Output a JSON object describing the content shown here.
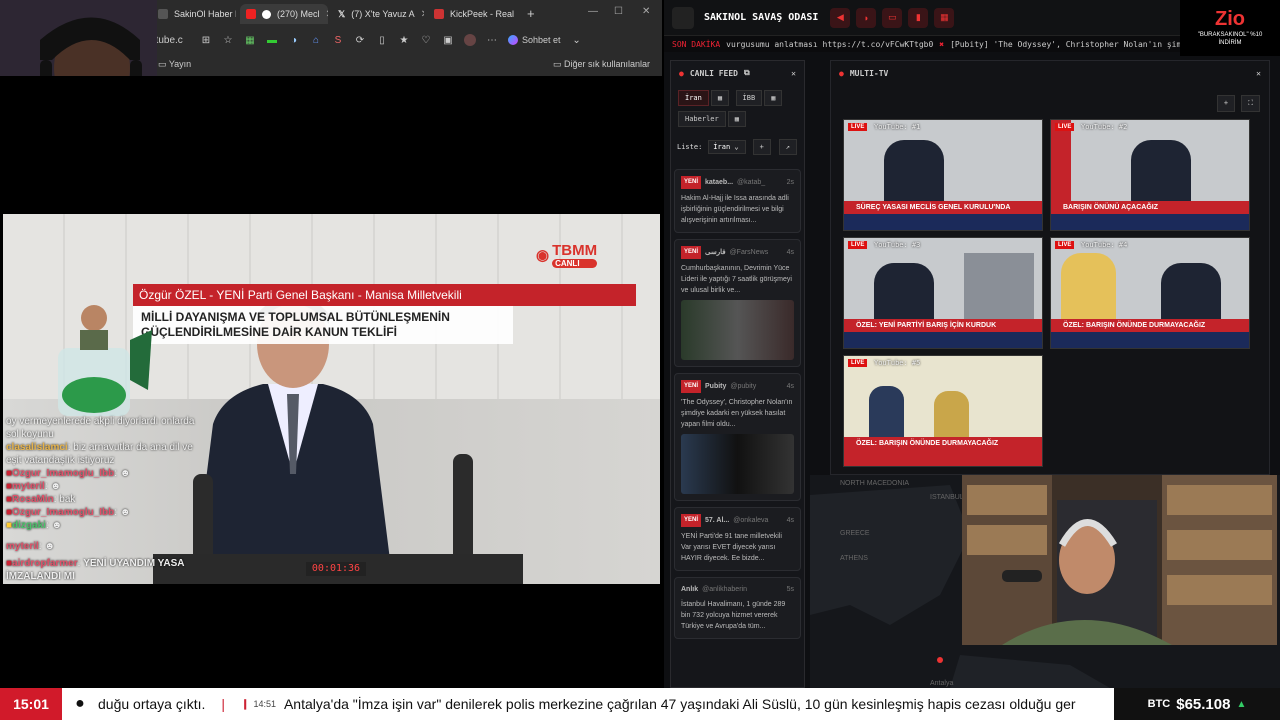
{
  "browser": {
    "tabs": [
      {
        "label": "SakinOl Haber N"
      },
      {
        "label": "(270) Mecl"
      },
      {
        "label": "(7) X'te Yavuz A"
      },
      {
        "label": "KickPeek - Real"
      }
    ],
    "address": "utube.c",
    "profile_button": "Sohbet et",
    "bookmark_1": "Yayın",
    "bookmark_other": "Diğer sık kullanılanlar"
  },
  "stream": {
    "channel_logo": "TBMM",
    "channel_sub": "CANLI",
    "speaker_line": "Özgür ÖZEL - YENİ Parti Genel Başkanı - Manisa Milletvekili",
    "topic_line1": "MİLLİ DAYANIŞMA VE TOPLUMSAL BÜTÜNLEŞMENİN",
    "topic_line2": "GÜÇLENDİRİLMESİNE DAİR KANUN TEKLİFİ",
    "timer": "00:01:36"
  },
  "chat": [
    {
      "user": "",
      "text": "oy vermeyenlerede akpli diyorlardı onlarda sol koyunu",
      "color": "#ddd"
    },
    {
      "user": "clasalislamci",
      "text": "biz arnavutlar da ana dil ve eşit vatandaşlık istiyoruz",
      "color": "#e6b34a"
    },
    {
      "user": "Ozgur_Imamoglu_Ibb",
      "text": "",
      "color": "#e0526a"
    },
    {
      "user": "myteril",
      "text": "",
      "color": "#e0526a"
    },
    {
      "user": "RosaMin",
      "text": "bak",
      "color": "#e0526a"
    },
    {
      "user": "Ozgur_Imamoglu_Ibb",
      "text": "",
      "color": "#e0526a"
    },
    {
      "user": "dizgaki",
      "text": "",
      "color": "#4ac26a"
    },
    {
      "user": "myteril",
      "text": "",
      "color": "#e0526a"
    },
    {
      "user": "airdropfarmer",
      "text": "YENİ UYANDIM YASA İMZALANDI MI",
      "color": "#e0526a"
    }
  ],
  "dashboard": {
    "title": "SAKINOL SAVAŞ ODASI",
    "ticker_tag": "SON DAKİKA",
    "ticker_text": "vurgusumu anlatması https://t.co/vFCwKTtgb0",
    "ticker_text2": "[Pubity] 'The Odyssey', Christopher Nolan'ın şimdiye kadarki en y",
    "feed_title": "CANLI FEED",
    "chips": [
      "İran",
      "İBB",
      "Haberler"
    ],
    "list_label": "Liste:",
    "list_value": "İran",
    "multitv_title": "MULTI-TV",
    "tiles": [
      {
        "label": "YouTube: #1",
        "banner": "SÜREÇ YASASI MECLİS GENEL KURULU'NDA"
      },
      {
        "label": "YouTube: #2",
        "banner": "BARIŞIN ÖNÜNÜ AÇACAĞIZ"
      },
      {
        "label": "YouTube: #3",
        "banner": "ÖZEL: YENİ PARTİYİ BARIŞ İÇİN KURDUK"
      },
      {
        "label": "YouTube: #4",
        "banner": "ÖZEL: BARIŞIN ÖNÜNDE DURMAYACAĞIZ"
      },
      {
        "label": "YouTube: #5",
        "banner": "ÖZEL: BARIŞIN ÖNÜNDE DURMAYACAĞIZ"
      }
    ],
    "cards": [
      {
        "badge": "YENİ",
        "source": "kataeb...",
        "handle": "@katab_",
        "time": "2s",
        "text": "Hakim Al-Hajj ile Issa arasında adli işbirliğinin güçlendirilmesi ve bilgi alışverişinin artırılması..."
      },
      {
        "badge": "YENİ",
        "source": "فارسی",
        "handle": "@FarsNews",
        "time": "4s",
        "text": "Cumhurbaşkanının, Devrimin Yüce Lideri ile yaptığı 7 saatlik görüşmeyi ve ulusal birlik ve..."
      },
      {
        "badge": "YENİ",
        "source": "Pubity",
        "handle": "@pubity",
        "time": "4s",
        "text": "'The Odyssey', Christopher Nolan'ın şimdiye kadarki en yüksek hasılat yapan filmi oldu..."
      },
      {
        "badge": "YENİ",
        "source": "57. Al...",
        "handle": "@onkaleva",
        "time": "4s",
        "text": "YENİ Parti'de 91 tane milletvekili Var yarısı EVET diyecek yarısı HAYIR diyecek. Ee bizde..."
      },
      {
        "badge": "",
        "source": "Anlık",
        "handle": "@anlikhaberin",
        "time": "5s",
        "text": "İstanbul Havalimanı, 1 günde 289 bin 732 yolcuya hizmet vererek Türkiye ve Avrupa'da tüm..."
      }
    ],
    "map_labels": [
      "NORTH MACEDONIA",
      "ISTANBUL",
      "GREECE",
      "ATHENS",
      "Antalya"
    ]
  },
  "overlay": {
    "brand": "Zio",
    "promo": "\"BURAKSAKINOL\" %10 İNDİRİM"
  },
  "bottom": {
    "clock": "15:01",
    "news_left": "duğu ortaya çıktı.",
    "news_time": "14:51",
    "news_main": "Antalya'da \"İmza işin var\" denilerek polis merkezine çağrılan 47 yaşındaki Ali Süslü, 10 gün kesinleşmiş hapis cezası olduğu ger",
    "btc_label": "BTC",
    "btc_value": "$65.108"
  }
}
